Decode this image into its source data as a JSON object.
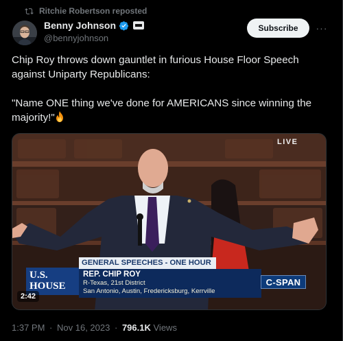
{
  "repost": {
    "icon": "repost-icon",
    "text": "Ritchie Robertson reposted"
  },
  "author": {
    "display_name": "Benny Johnson",
    "handle": "@bennyjohnson",
    "verified_icon": "verified-badge-icon",
    "verified_color": "#1d9bf0",
    "affiliate_icon": "affiliate-badge-icon"
  },
  "actions": {
    "subscribe_label": "Subscribe",
    "more_icon": "more-icon",
    "more_label": "···"
  },
  "tweet": {
    "line1": "Chip Roy throws down gauntlet in furious House Floor Speech against Uniparty Republicans:",
    "line2": "\"Name ONE thing we've done for AMERICANS since winning the majority!\"",
    "emoji_icon": "fire-emoji-icon"
  },
  "video": {
    "live_label": "LIVE",
    "duration": "2:42",
    "chyron_heading": "GENERAL SPEECHES - ONE HOUR",
    "chyron_name": "REP. CHIP ROY",
    "chyron_district": "R-Texas, 21st District",
    "chyron_cities": "San Antonio, Austin, Fredericksburg, Kerrville",
    "house_logo_line1": "U.S.",
    "house_logo_line2": "HOUSE",
    "network_logo": "C-SPAN"
  },
  "meta": {
    "time": "1:37 PM",
    "separator": "·",
    "date": "Nov 16, 2023",
    "views_count": "796.1K",
    "views_label": "Views"
  },
  "colors": {
    "background": "#000000",
    "text": "#e7e9ea",
    "muted": "#71767b",
    "accent": "#1d9bf0"
  }
}
